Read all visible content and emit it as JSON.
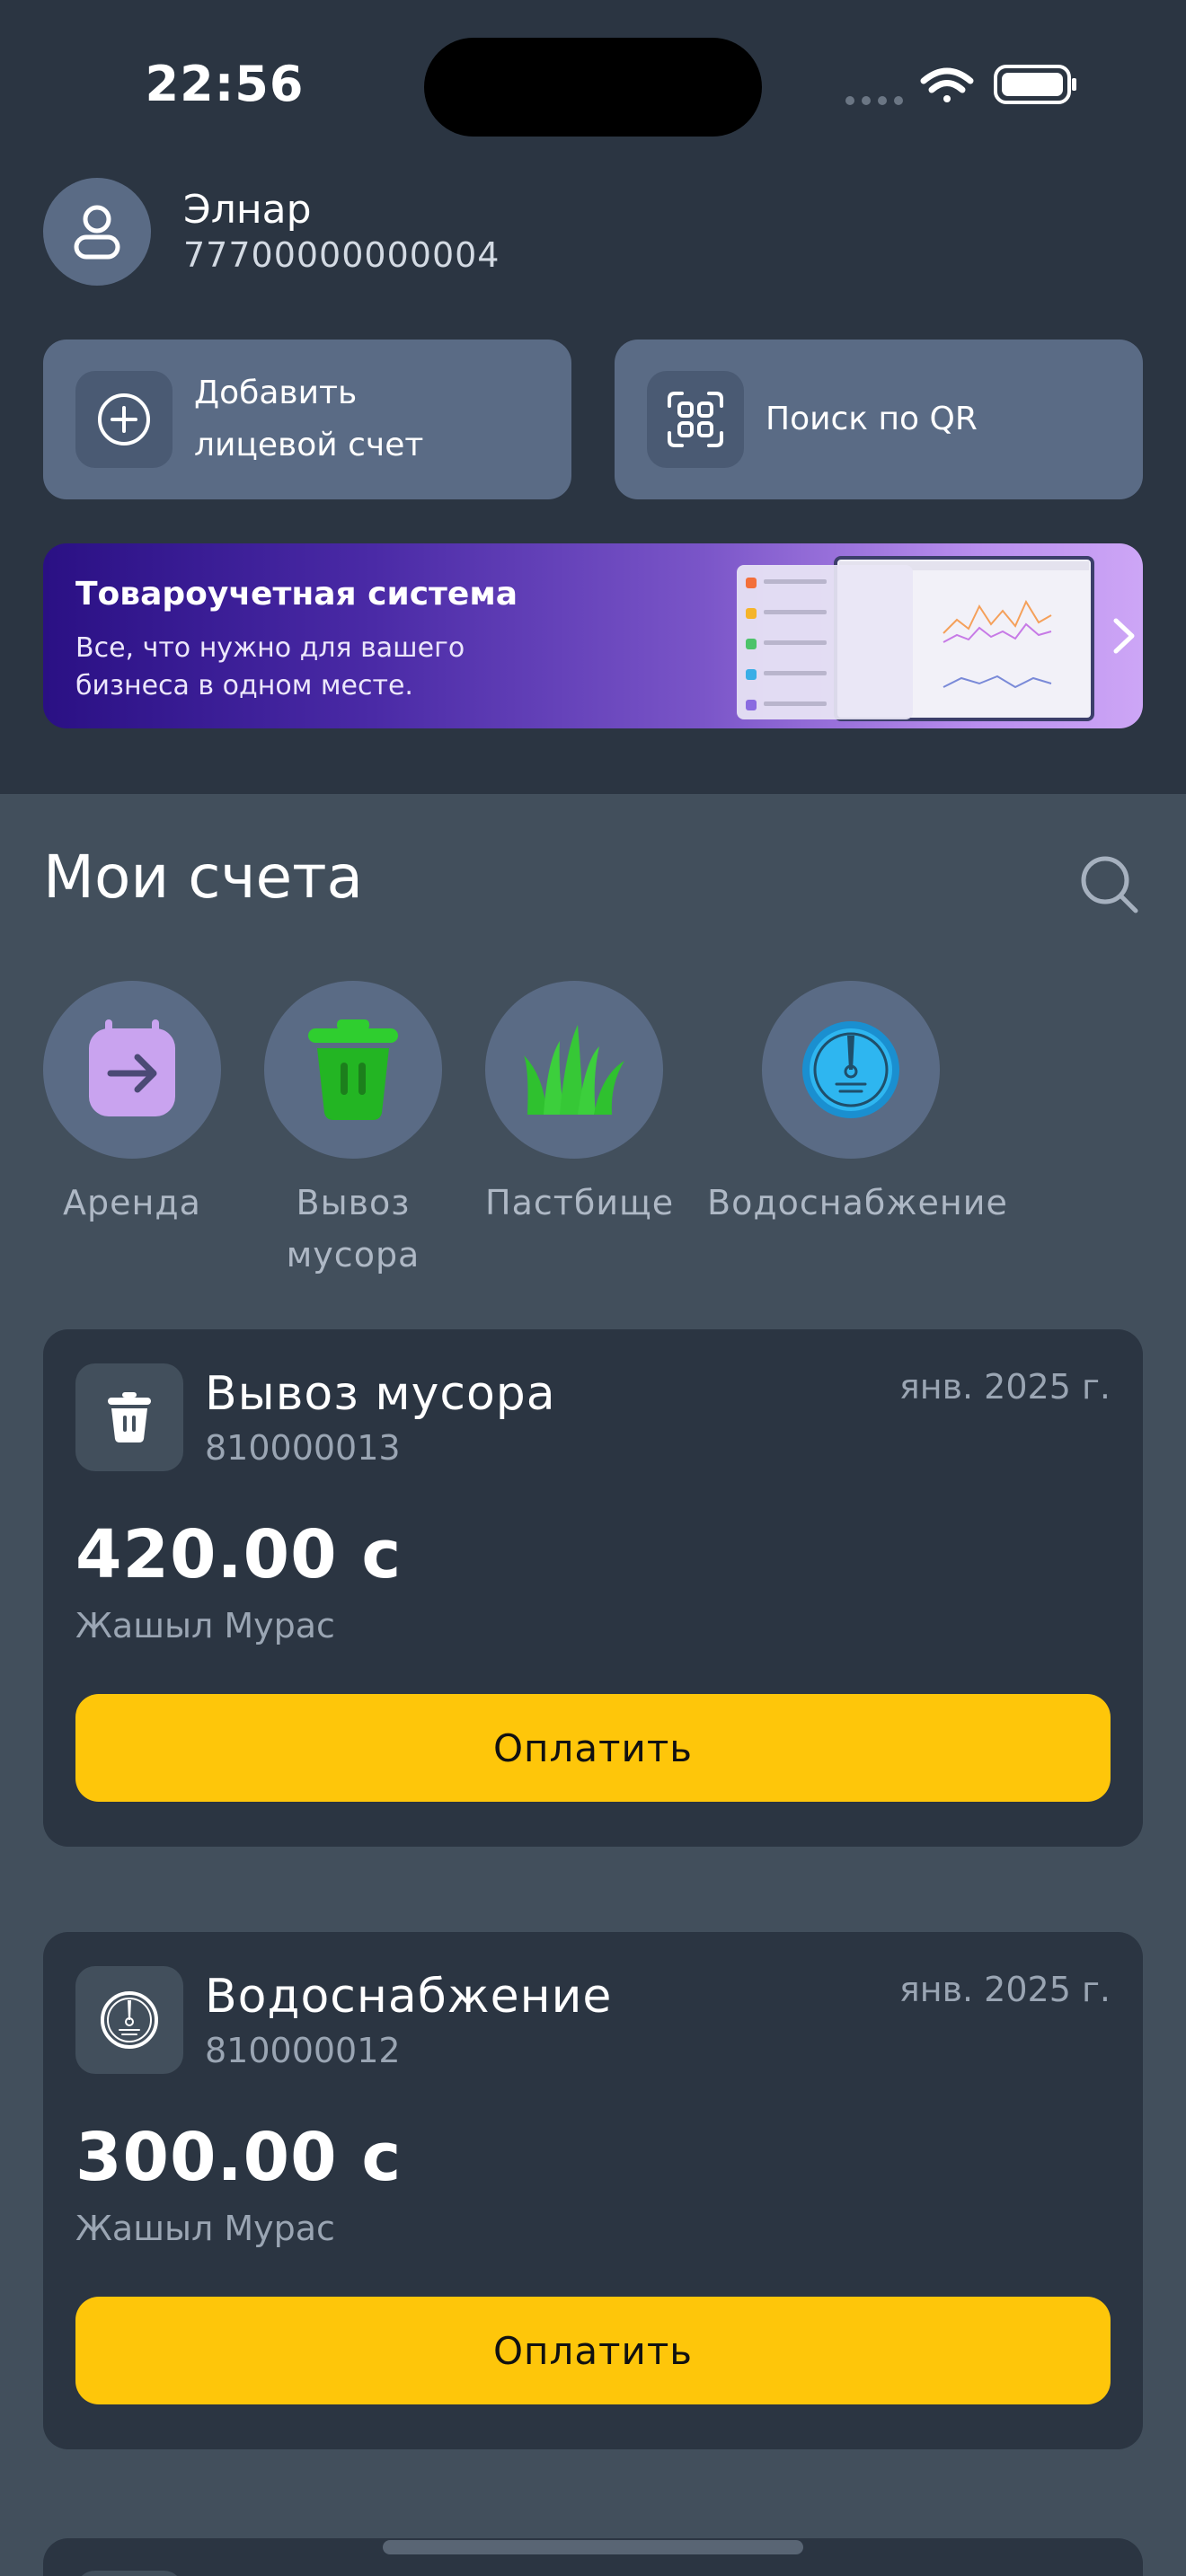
{
  "status_bar": {
    "time": "22:56"
  },
  "user": {
    "name": "Элнар",
    "phone": "77700000000004"
  },
  "actions": {
    "add_account": {
      "line1": "Добавить",
      "line2": "лицевой счет",
      "icon": "plus-circle-icon"
    },
    "qr_search": {
      "label": "Поиск по QR",
      "icon": "qr-scan-icon"
    }
  },
  "banner": {
    "title": "Товароучетная система",
    "line1": "Все, что нужно для вашего",
    "line2": "бизнеса в одном месте."
  },
  "section": {
    "title": "Мои счета"
  },
  "categories": [
    {
      "line1": "Аренда",
      "line2": "",
      "icon": "rent-calendar-icon",
      "color": "#c9a3ef"
    },
    {
      "line1": "Вывоз",
      "line2": "мусора",
      "icon": "trash-bin-icon",
      "color": "#2fce2f"
    },
    {
      "line1": "Пастбище",
      "line2": "",
      "icon": "grass-icon",
      "color": "#3ccf3c"
    },
    {
      "line1": "Водоснабжение",
      "line2": "",
      "icon": "water-meter-icon",
      "color": "#2eb6f0"
    }
  ],
  "bills": [
    {
      "title": "Вывоз мусора",
      "account": "810000013",
      "date": "янв. 2025 г.",
      "amount": "420.00 с",
      "provider": "Жашыл Мурас",
      "pay_label": "Оплатить",
      "icon": "trash-bin-icon"
    },
    {
      "title": "Водоснабжение",
      "account": "810000012",
      "date": "янв. 2025 г.",
      "amount": "300.00 с",
      "provider": "Жашыл Мурас",
      "pay_label": "Оплатить",
      "icon": "water-meter-icon"
    }
  ],
  "colors": {
    "header_bg": "#2b3542",
    "page_bg": "#424f5c",
    "tile_bg": "#5a6b85",
    "pay_button": "#fec60a"
  }
}
